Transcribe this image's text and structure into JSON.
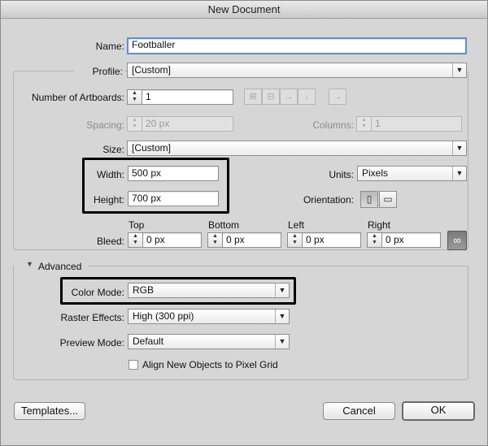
{
  "window": {
    "title": "New Document"
  },
  "name": {
    "label": "Name:",
    "value": "Footballer"
  },
  "profile": {
    "label": "Profile:",
    "value": "[Custom]"
  },
  "artboards": {
    "label": "Number of Artboards:",
    "value": "1",
    "spacing_label": "Spacing:",
    "spacing_value": "20 px",
    "columns_label": "Columns:",
    "columns_value": "1"
  },
  "size": {
    "label": "Size:",
    "value": "[Custom]"
  },
  "width": {
    "label": "Width:",
    "value": "500 px"
  },
  "height": {
    "label": "Height:",
    "value": "700 px"
  },
  "units": {
    "label": "Units:",
    "value": "Pixels"
  },
  "orientation": {
    "label": "Orientation:"
  },
  "bleed": {
    "label": "Bleed:",
    "top_label": "Top",
    "top_value": "0 px",
    "bottom_label": "Bottom",
    "bottom_value": "0 px",
    "left_label": "Left",
    "left_value": "0 px",
    "right_label": "Right",
    "right_value": "0 px"
  },
  "advanced": {
    "label": "Advanced",
    "color_mode_label": "Color Mode:",
    "color_mode_value": "RGB",
    "raster_label": "Raster Effects:",
    "raster_value": "High (300 ppi)",
    "preview_label": "Preview Mode:",
    "preview_value": "Default",
    "align_label": "Align New Objects to Pixel Grid"
  },
  "buttons": {
    "templates": "Templates...",
    "cancel": "Cancel",
    "ok": "OK"
  },
  "icons": {
    "grid_by_row": "grid-by-row-icon",
    "grid_by_column": "grid-by-column-icon",
    "arrange_by_row": "arrange-by-row-icon",
    "arrange_by_column": "arrange-by-column-icon",
    "right_to_left": "right-to-left-icon",
    "portrait": "portrait-icon",
    "landscape": "landscape-icon",
    "link": "link-icon",
    "disclosure": "disclosure-triangle-icon"
  },
  "colors": {
    "focus_ring": "#5a8fd6",
    "highlight_box": "#000000"
  }
}
